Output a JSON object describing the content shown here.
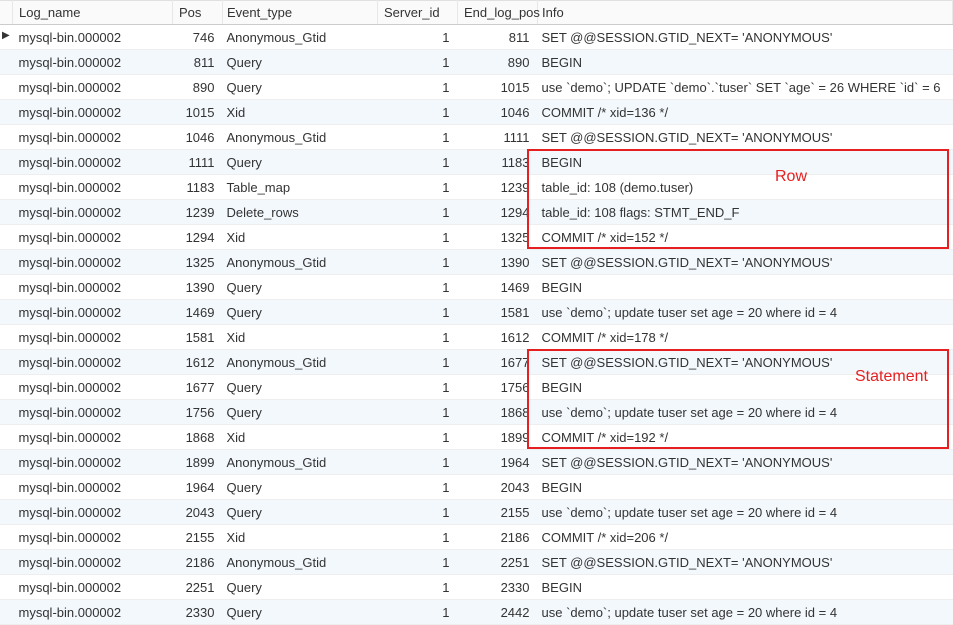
{
  "columns": {
    "log_name": "Log_name",
    "pos": "Pos",
    "event_type": "Event_type",
    "server_id": "Server_id",
    "end_log_pos": "End_log_pos",
    "info": "Info"
  },
  "annotations": {
    "row_label": "Row",
    "statement_label": "Statement"
  },
  "rows": [
    {
      "log_name": "mysql-bin.000002",
      "pos": "746",
      "event_type": "Anonymous_Gtid",
      "server_id": "1",
      "end_log_pos": "811",
      "info": "SET @@SESSION.GTID_NEXT= 'ANONYMOUS'"
    },
    {
      "log_name": "mysql-bin.000002",
      "pos": "811",
      "event_type": "Query",
      "server_id": "1",
      "end_log_pos": "890",
      "info": "BEGIN"
    },
    {
      "log_name": "mysql-bin.000002",
      "pos": "890",
      "event_type": "Query",
      "server_id": "1",
      "end_log_pos": "1015",
      "info": "use `demo`; UPDATE `demo`.`tuser` SET `age` = 26 WHERE `id` = 6"
    },
    {
      "log_name": "mysql-bin.000002",
      "pos": "1015",
      "event_type": "Xid",
      "server_id": "1",
      "end_log_pos": "1046",
      "info": "COMMIT /* xid=136 */"
    },
    {
      "log_name": "mysql-bin.000002",
      "pos": "1046",
      "event_type": "Anonymous_Gtid",
      "server_id": "1",
      "end_log_pos": "1111",
      "info": "SET @@SESSION.GTID_NEXT= 'ANONYMOUS'"
    },
    {
      "log_name": "mysql-bin.000002",
      "pos": "1111",
      "event_type": "Query",
      "server_id": "1",
      "end_log_pos": "1183",
      "info": "BEGIN"
    },
    {
      "log_name": "mysql-bin.000002",
      "pos": "1183",
      "event_type": "Table_map",
      "server_id": "1",
      "end_log_pos": "1239",
      "info": "table_id: 108 (demo.tuser)"
    },
    {
      "log_name": "mysql-bin.000002",
      "pos": "1239",
      "event_type": "Delete_rows",
      "server_id": "1",
      "end_log_pos": "1294",
      "info": "table_id: 108 flags: STMT_END_F"
    },
    {
      "log_name": "mysql-bin.000002",
      "pos": "1294",
      "event_type": "Xid",
      "server_id": "1",
      "end_log_pos": "1325",
      "info": "COMMIT /* xid=152 */"
    },
    {
      "log_name": "mysql-bin.000002",
      "pos": "1325",
      "event_type": "Anonymous_Gtid",
      "server_id": "1",
      "end_log_pos": "1390",
      "info": "SET @@SESSION.GTID_NEXT= 'ANONYMOUS'"
    },
    {
      "log_name": "mysql-bin.000002",
      "pos": "1390",
      "event_type": "Query",
      "server_id": "1",
      "end_log_pos": "1469",
      "info": "BEGIN"
    },
    {
      "log_name": "mysql-bin.000002",
      "pos": "1469",
      "event_type": "Query",
      "server_id": "1",
      "end_log_pos": "1581",
      "info": "use `demo`; update tuser set age = 20 where id = 4"
    },
    {
      "log_name": "mysql-bin.000002",
      "pos": "1581",
      "event_type": "Xid",
      "server_id": "1",
      "end_log_pos": "1612",
      "info": "COMMIT /* xid=178 */"
    },
    {
      "log_name": "mysql-bin.000002",
      "pos": "1612",
      "event_type": "Anonymous_Gtid",
      "server_id": "1",
      "end_log_pos": "1677",
      "info": "SET @@SESSION.GTID_NEXT= 'ANONYMOUS'"
    },
    {
      "log_name": "mysql-bin.000002",
      "pos": "1677",
      "event_type": "Query",
      "server_id": "1",
      "end_log_pos": "1756",
      "info": "BEGIN"
    },
    {
      "log_name": "mysql-bin.000002",
      "pos": "1756",
      "event_type": "Query",
      "server_id": "1",
      "end_log_pos": "1868",
      "info": "use `demo`; update tuser set age = 20 where id = 4"
    },
    {
      "log_name": "mysql-bin.000002",
      "pos": "1868",
      "event_type": "Xid",
      "server_id": "1",
      "end_log_pos": "1899",
      "info": "COMMIT /* xid=192 */"
    },
    {
      "log_name": "mysql-bin.000002",
      "pos": "1899",
      "event_type": "Anonymous_Gtid",
      "server_id": "1",
      "end_log_pos": "1964",
      "info": "SET @@SESSION.GTID_NEXT= 'ANONYMOUS'"
    },
    {
      "log_name": "mysql-bin.000002",
      "pos": "1964",
      "event_type": "Query",
      "server_id": "1",
      "end_log_pos": "2043",
      "info": "BEGIN"
    },
    {
      "log_name": "mysql-bin.000002",
      "pos": "2043",
      "event_type": "Query",
      "server_id": "1",
      "end_log_pos": "2155",
      "info": "use `demo`; update tuser set age = 20 where id = 4"
    },
    {
      "log_name": "mysql-bin.000002",
      "pos": "2155",
      "event_type": "Xid",
      "server_id": "1",
      "end_log_pos": "2186",
      "info": "COMMIT /* xid=206 */"
    },
    {
      "log_name": "mysql-bin.000002",
      "pos": "2186",
      "event_type": "Anonymous_Gtid",
      "server_id": "1",
      "end_log_pos": "2251",
      "info": "SET @@SESSION.GTID_NEXT= 'ANONYMOUS'"
    },
    {
      "log_name": "mysql-bin.000002",
      "pos": "2251",
      "event_type": "Query",
      "server_id": "1",
      "end_log_pos": "2330",
      "info": "BEGIN"
    },
    {
      "log_name": "mysql-bin.000002",
      "pos": "2330",
      "event_type": "Query",
      "server_id": "1",
      "end_log_pos": "2442",
      "info": "use `demo`; update tuser set age = 20 where id = 4"
    }
  ]
}
